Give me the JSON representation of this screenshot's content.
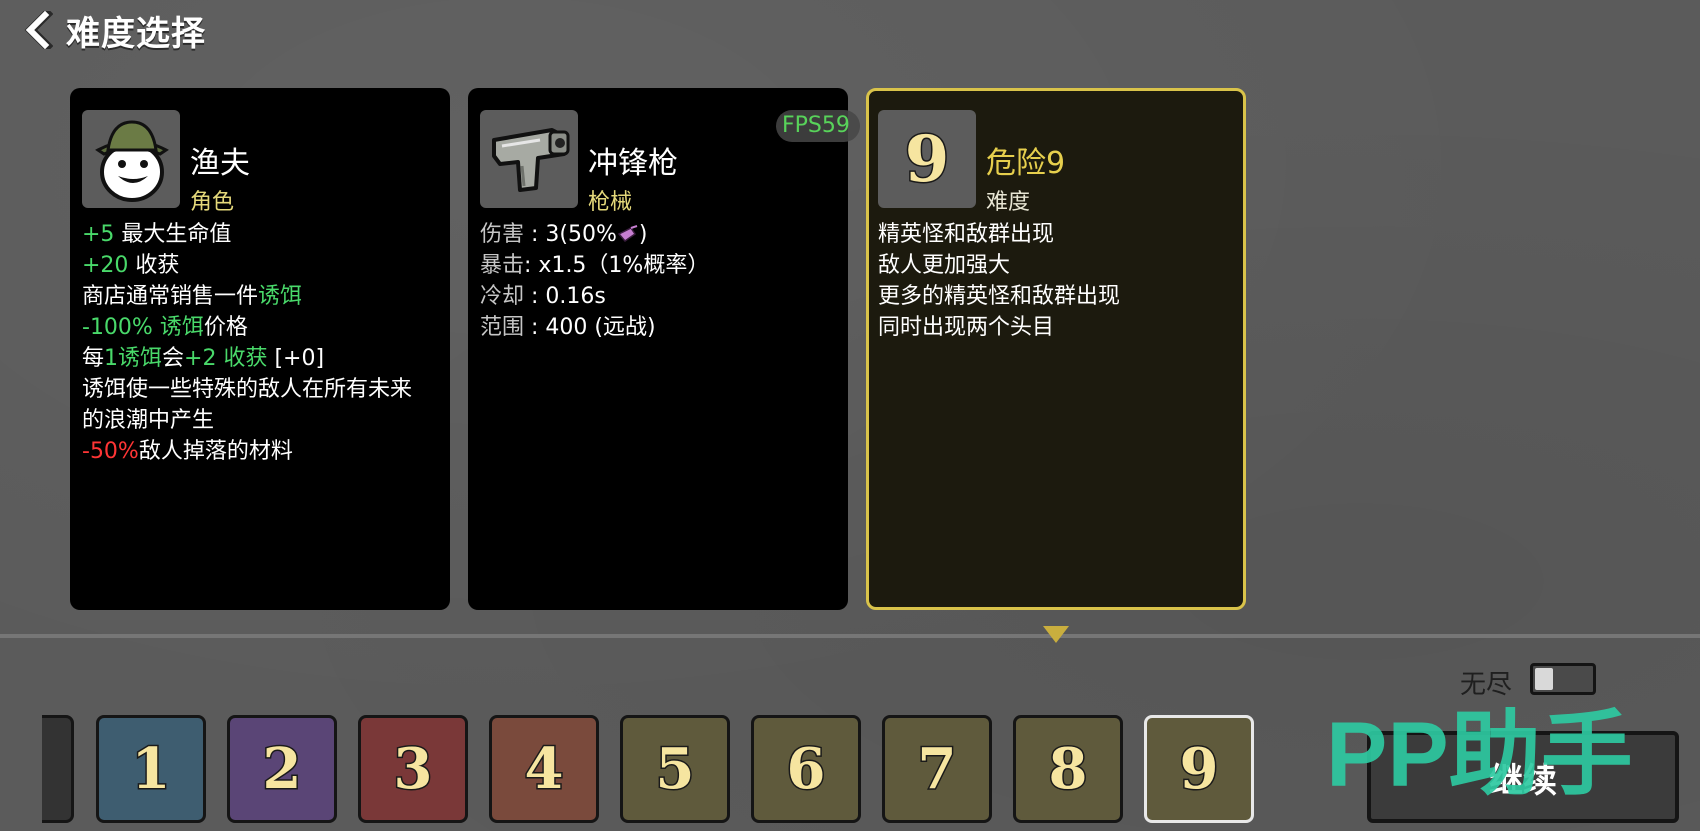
{
  "header": {
    "title": "难度选择"
  },
  "fps": "FPS59",
  "character_card": {
    "name": "渔夫",
    "type": "角色",
    "lines": [
      [
        "+5",
        " 最大生命值"
      ],
      [
        "+20",
        " 收获"
      ],
      [
        "商店通常销售一件",
        "诱饵"
      ],
      [
        "-100% 诱饵",
        "价格"
      ],
      [
        "每",
        "1诱饵",
        "会",
        "+2 收获",
        " [+0]"
      ],
      [
        "诱饵使一些特殊的敌人在所有未来"
      ],
      [
        "的浪潮中产生"
      ],
      [
        "-50%",
        "敌人掉落的材料"
      ]
    ]
  },
  "weapon_card": {
    "name": "冲锋枪",
    "type": "枪械",
    "stats": [
      {
        "label": "伤害",
        "sep": " : ",
        "value": "3(50%",
        "suffix": ")"
      },
      {
        "label": "暴击",
        "sep": ":  ",
        "value": "x1.5（1%概率）"
      },
      {
        "label": "冷却",
        "sep": " : ",
        "value": "0.16s"
      },
      {
        "label": "范围",
        "sep": " : ",
        "value": "400 (远战)"
      }
    ]
  },
  "difficulty_card": {
    "icon_numeral": "9",
    "name": "危险9",
    "type": "难度",
    "lines": [
      "精英怪和敌群出现",
      "敌人更加强大",
      "更多的精英怪和敌群出现",
      "同时出现两个头目"
    ]
  },
  "difficulty_selector": {
    "endless_label": "无尽",
    "endless_on": false,
    "selected": "9",
    "tiles": [
      {
        "label": "1",
        "color": "#3e5d70"
      },
      {
        "label": "2",
        "color": "#5a4576"
      },
      {
        "label": "3",
        "color": "#7a3838"
      },
      {
        "label": "4",
        "color": "#7a4a3c"
      },
      {
        "label": "5",
        "color": "#5f5a3c"
      },
      {
        "label": "6",
        "color": "#5f5a3c"
      },
      {
        "label": "7",
        "color": "#5f5a3c"
      },
      {
        "label": "8",
        "color": "#5f5a3c"
      },
      {
        "label": "9",
        "color": "#5f5a3c"
      }
    ]
  },
  "continue_button": {
    "label": "继续"
  },
  "watermark": {
    "text": "PP助手",
    "color": "#2ec9a1"
  },
  "colors": {
    "accent_gold": "#d9c34a",
    "positive": "#49d96a",
    "negative": "#ff3535"
  }
}
